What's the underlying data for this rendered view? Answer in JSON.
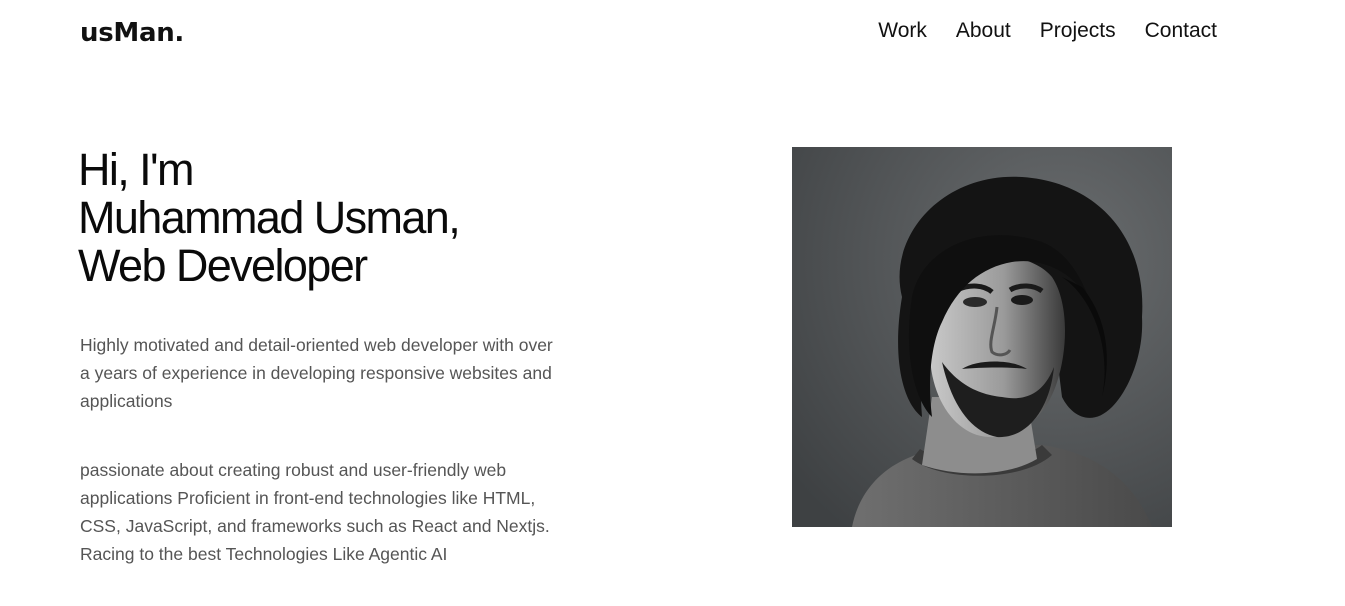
{
  "header": {
    "logo": "usMan.",
    "nav": [
      {
        "label": "Work"
      },
      {
        "label": "About"
      },
      {
        "label": "Projects"
      },
      {
        "label": "Contact"
      }
    ]
  },
  "hero": {
    "title_lines": [
      "Hi, I'm",
      "Muhammad Usman,",
      "Web Developer"
    ],
    "paragraph1": "Highly motivated and detail-oriented web developer with over a years of experience in developing responsive websites and applications",
    "paragraph2": "passionate about creating robust and user-friendly web applications Proficient in front-end technologies like HTML, CSS, JavaScript, and frameworks such as React and Nextjs. Racing to the best Technologies Like Agentic AI"
  },
  "colors": {
    "text": "#111111",
    "muted": "#555555",
    "background": "#ffffff",
    "photo_bg": "#4f5254"
  },
  "icons": [
    "portrait-photo"
  ]
}
